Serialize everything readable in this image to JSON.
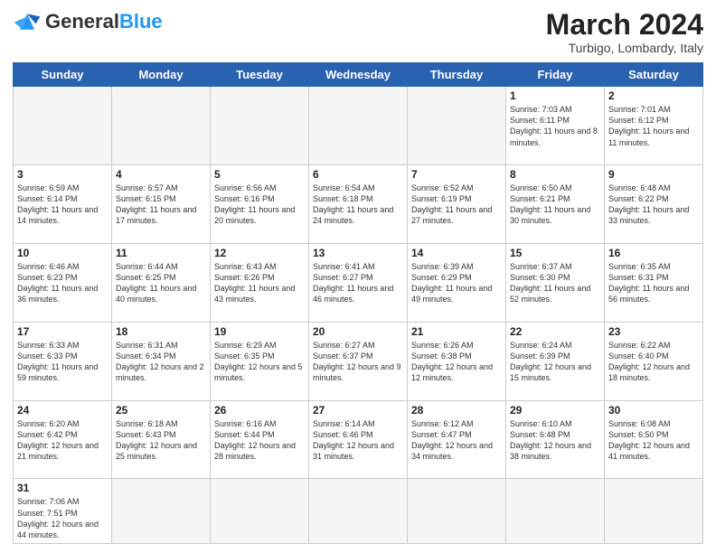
{
  "header": {
    "logo_general": "General",
    "logo_blue": "Blue",
    "month_title": "March 2024",
    "location": "Turbigo, Lombardy, Italy"
  },
  "days_of_week": [
    "Sunday",
    "Monday",
    "Tuesday",
    "Wednesday",
    "Thursday",
    "Friday",
    "Saturday"
  ],
  "weeks": [
    [
      {
        "day": "",
        "info": ""
      },
      {
        "day": "",
        "info": ""
      },
      {
        "day": "",
        "info": ""
      },
      {
        "day": "",
        "info": ""
      },
      {
        "day": "",
        "info": ""
      },
      {
        "day": "1",
        "info": "Sunrise: 7:03 AM\nSunset: 6:11 PM\nDaylight: 11 hours\nand 8 minutes."
      },
      {
        "day": "2",
        "info": "Sunrise: 7:01 AM\nSunset: 6:12 PM\nDaylight: 11 hours\nand 11 minutes."
      }
    ],
    [
      {
        "day": "3",
        "info": "Sunrise: 6:59 AM\nSunset: 6:14 PM\nDaylight: 11 hours\nand 14 minutes."
      },
      {
        "day": "4",
        "info": "Sunrise: 6:57 AM\nSunset: 6:15 PM\nDaylight: 11 hours\nand 17 minutes."
      },
      {
        "day": "5",
        "info": "Sunrise: 6:56 AM\nSunset: 6:16 PM\nDaylight: 11 hours\nand 20 minutes."
      },
      {
        "day": "6",
        "info": "Sunrise: 6:54 AM\nSunset: 6:18 PM\nDaylight: 11 hours\nand 24 minutes."
      },
      {
        "day": "7",
        "info": "Sunrise: 6:52 AM\nSunset: 6:19 PM\nDaylight: 11 hours\nand 27 minutes."
      },
      {
        "day": "8",
        "info": "Sunrise: 6:50 AM\nSunset: 6:21 PM\nDaylight: 11 hours\nand 30 minutes."
      },
      {
        "day": "9",
        "info": "Sunrise: 6:48 AM\nSunset: 6:22 PM\nDaylight: 11 hours\nand 33 minutes."
      }
    ],
    [
      {
        "day": "10",
        "info": "Sunrise: 6:46 AM\nSunset: 6:23 PM\nDaylight: 11 hours\nand 36 minutes."
      },
      {
        "day": "11",
        "info": "Sunrise: 6:44 AM\nSunset: 6:25 PM\nDaylight: 11 hours\nand 40 minutes."
      },
      {
        "day": "12",
        "info": "Sunrise: 6:43 AM\nSunset: 6:26 PM\nDaylight: 11 hours\nand 43 minutes."
      },
      {
        "day": "13",
        "info": "Sunrise: 6:41 AM\nSunset: 6:27 PM\nDaylight: 11 hours\nand 46 minutes."
      },
      {
        "day": "14",
        "info": "Sunrise: 6:39 AM\nSunset: 6:29 PM\nDaylight: 11 hours\nand 49 minutes."
      },
      {
        "day": "15",
        "info": "Sunrise: 6:37 AM\nSunset: 6:30 PM\nDaylight: 11 hours\nand 52 minutes."
      },
      {
        "day": "16",
        "info": "Sunrise: 6:35 AM\nSunset: 6:31 PM\nDaylight: 11 hours\nand 56 minutes."
      }
    ],
    [
      {
        "day": "17",
        "info": "Sunrise: 6:33 AM\nSunset: 6:33 PM\nDaylight: 11 hours\nand 59 minutes."
      },
      {
        "day": "18",
        "info": "Sunrise: 6:31 AM\nSunset: 6:34 PM\nDaylight: 12 hours\nand 2 minutes."
      },
      {
        "day": "19",
        "info": "Sunrise: 6:29 AM\nSunset: 6:35 PM\nDaylight: 12 hours\nand 5 minutes."
      },
      {
        "day": "20",
        "info": "Sunrise: 6:27 AM\nSunset: 6:37 PM\nDaylight: 12 hours\nand 9 minutes."
      },
      {
        "day": "21",
        "info": "Sunrise: 6:26 AM\nSunset: 6:38 PM\nDaylight: 12 hours\nand 12 minutes."
      },
      {
        "day": "22",
        "info": "Sunrise: 6:24 AM\nSunset: 6:39 PM\nDaylight: 12 hours\nand 15 minutes."
      },
      {
        "day": "23",
        "info": "Sunrise: 6:22 AM\nSunset: 6:40 PM\nDaylight: 12 hours\nand 18 minutes."
      }
    ],
    [
      {
        "day": "24",
        "info": "Sunrise: 6:20 AM\nSunset: 6:42 PM\nDaylight: 12 hours\nand 21 minutes."
      },
      {
        "day": "25",
        "info": "Sunrise: 6:18 AM\nSunset: 6:43 PM\nDaylight: 12 hours\nand 25 minutes."
      },
      {
        "day": "26",
        "info": "Sunrise: 6:16 AM\nSunset: 6:44 PM\nDaylight: 12 hours\nand 28 minutes."
      },
      {
        "day": "27",
        "info": "Sunrise: 6:14 AM\nSunset: 6:46 PM\nDaylight: 12 hours\nand 31 minutes."
      },
      {
        "day": "28",
        "info": "Sunrise: 6:12 AM\nSunset: 6:47 PM\nDaylight: 12 hours\nand 34 minutes."
      },
      {
        "day": "29",
        "info": "Sunrise: 6:10 AM\nSunset: 6:48 PM\nDaylight: 12 hours\nand 38 minutes."
      },
      {
        "day": "30",
        "info": "Sunrise: 6:08 AM\nSunset: 6:50 PM\nDaylight: 12 hours\nand 41 minutes."
      }
    ],
    [
      {
        "day": "31",
        "info": "Sunrise: 7:06 AM\nSunset: 7:51 PM\nDaylight: 12 hours\nand 44 minutes."
      },
      {
        "day": "",
        "info": ""
      },
      {
        "day": "",
        "info": ""
      },
      {
        "day": "",
        "info": ""
      },
      {
        "day": "",
        "info": ""
      },
      {
        "day": "",
        "info": ""
      },
      {
        "day": "",
        "info": ""
      }
    ]
  ]
}
